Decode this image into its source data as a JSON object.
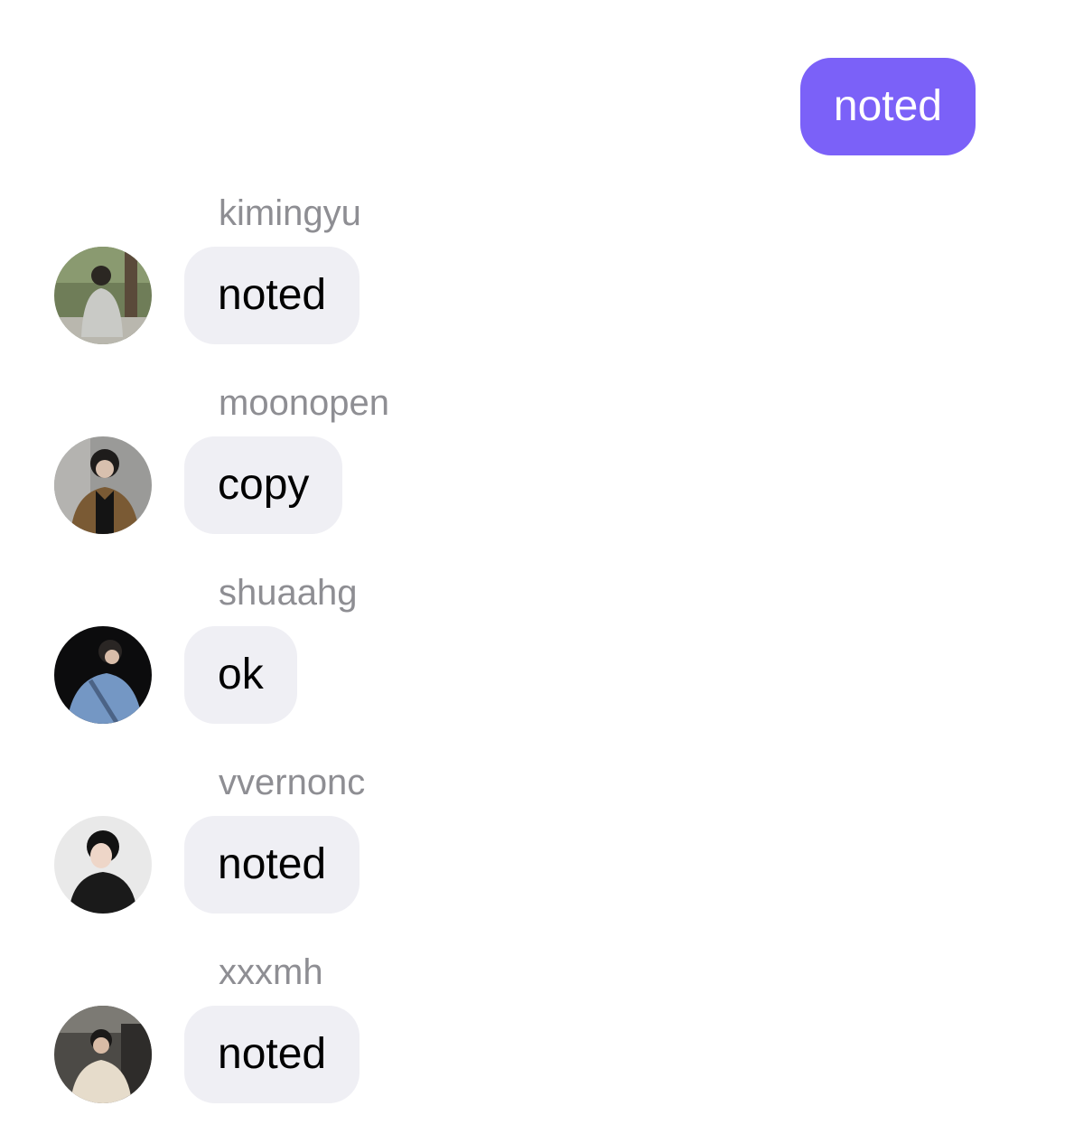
{
  "colors": {
    "outgoing_bubble": "#7B61F8",
    "incoming_bubble": "#EFEFF4",
    "sender_name": "#8E8E93"
  },
  "outgoing": {
    "text": "noted"
  },
  "messages": [
    {
      "sender": "kimingyu",
      "text": "noted",
      "avatar": "avatar-photo-person-grey-hoodie-outdoors"
    },
    {
      "sender": "moonopen",
      "text": "copy",
      "avatar": "avatar-photo-person-glasses-brown-jacket"
    },
    {
      "sender": "shuaahg",
      "text": "ok",
      "avatar": "avatar-photo-person-denim-jacket-dark"
    },
    {
      "sender": "vvernonc",
      "text": "noted",
      "avatar": "avatar-photo-person-black-hoodie-portrait"
    },
    {
      "sender": "xxxmh",
      "text": "noted",
      "avatar": "avatar-photo-person-cream-sweater"
    }
  ]
}
